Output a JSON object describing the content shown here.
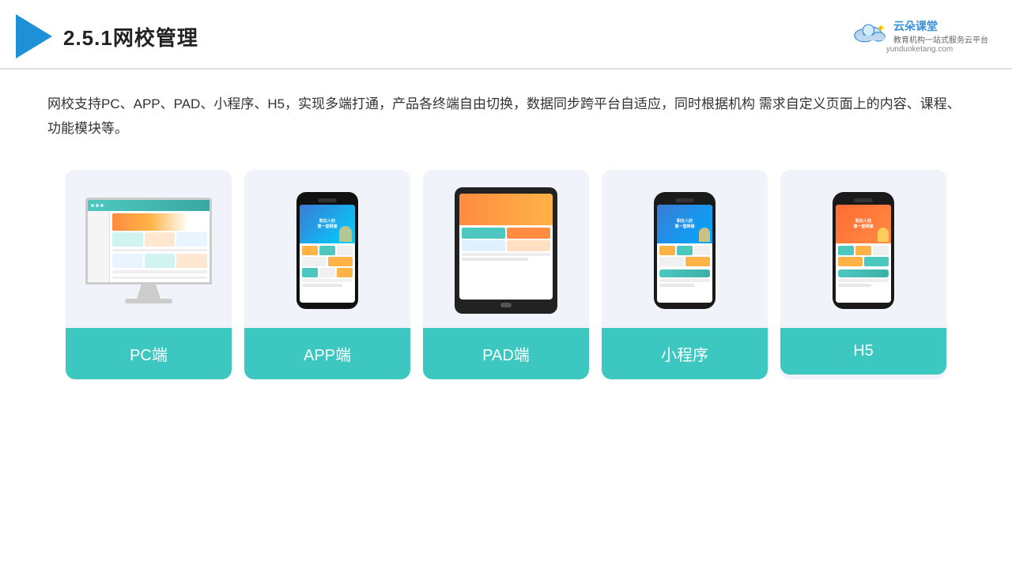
{
  "header": {
    "title": "2.5.1网校管理",
    "brand_name": "云朵课堂",
    "brand_slogan": "教育机构一站\n式服务云平台",
    "brand_url": "yunduoketang.com"
  },
  "description": "网校支持PC、APP、PAD、小程序、H5，实现多端打通，产品各终端自由切换，数据同步跨平台自适应，同时根据机构\n需求自定义页面上的内容、课程、功能模块等。",
  "cards": [
    {
      "id": "pc",
      "label": "PC端"
    },
    {
      "id": "app",
      "label": "APP端"
    },
    {
      "id": "pad",
      "label": "PAD端"
    },
    {
      "id": "miniprogram",
      "label": "小程序"
    },
    {
      "id": "h5",
      "label": "H5"
    }
  ],
  "colors": {
    "teal": "#3cc8c0",
    "blue": "#1e90d8",
    "accent_orange": "#ff8c40",
    "bg_card": "#f0f4fa"
  }
}
